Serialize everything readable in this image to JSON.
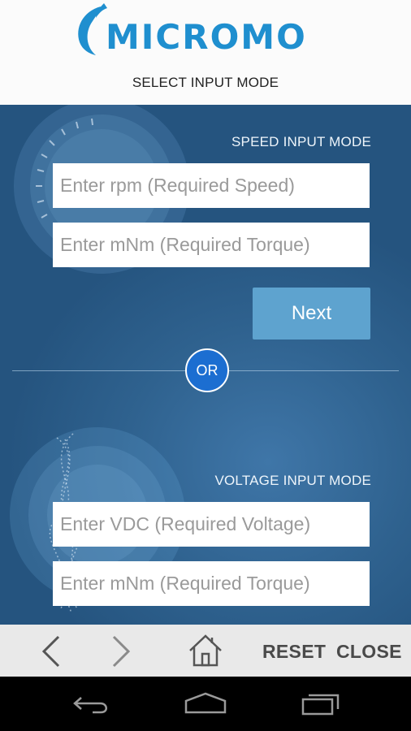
{
  "header": {
    "logo_text": "MICROMO",
    "title": "SELECT INPUT MODE"
  },
  "speed_mode": {
    "label": "SPEED INPUT MODE",
    "rpm_placeholder": "Enter rpm (Required Speed)",
    "torque_placeholder": "Enter mNm (Required Torque)",
    "next_label": "Next"
  },
  "divider": {
    "or_label": "OR"
  },
  "voltage_mode": {
    "label": "VOLTAGE INPUT MODE",
    "vdc_placeholder": "Enter VDC (Required Voltage)",
    "torque_placeholder": "Enter mNm (Required Torque)"
  },
  "toolbar": {
    "reset_label": "RESET",
    "close_label": "CLOSE"
  },
  "icons": [
    "back-arrow-icon",
    "forward-arrow-icon",
    "home-icon",
    "nav-back-icon",
    "nav-home-icon",
    "nav-recents-icon"
  ],
  "colors": {
    "brand": "#1f8fcf",
    "panel_bg": "#2f628f",
    "button_bg": "#5ea3cf",
    "or_bg": "#1c6ed1",
    "toolbar_bg": "#e9e9e9"
  }
}
